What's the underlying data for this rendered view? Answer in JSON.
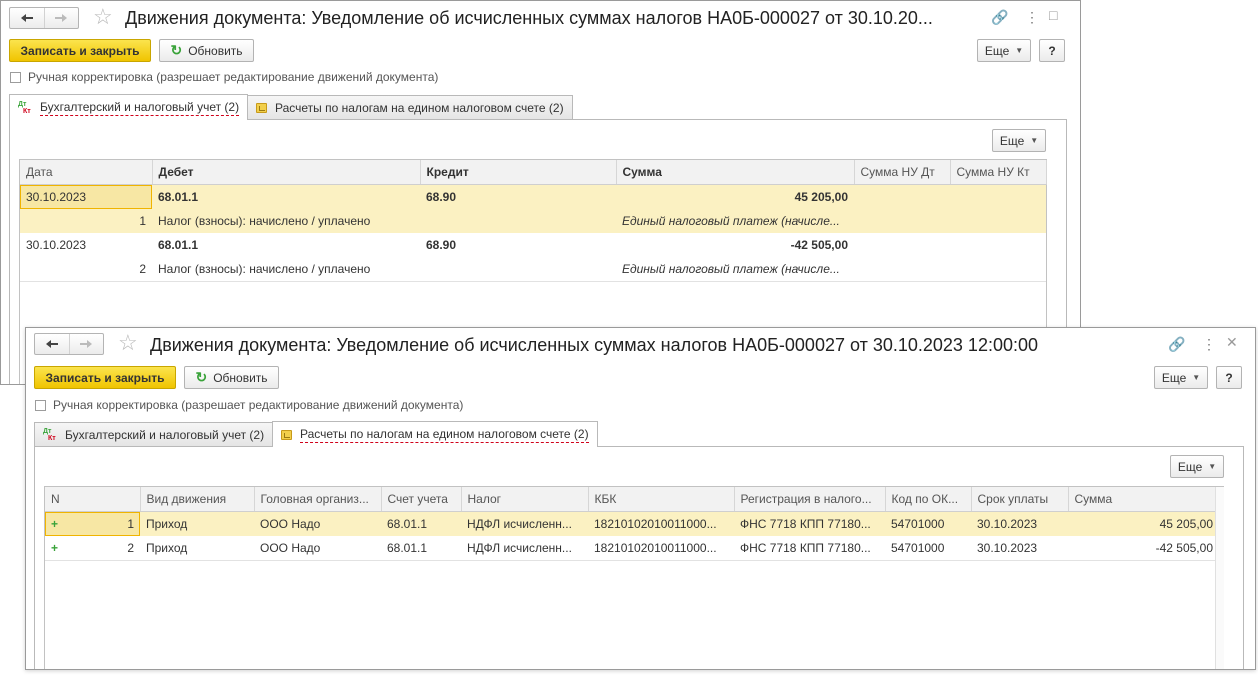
{
  "windows": [
    {
      "title": "Движения документа: Уведомление об исчисленных суммах налогов НА0Б-000027 от 30.10.20...",
      "save_close": "Записать и закрыть",
      "refresh": "Обновить",
      "more": "Еще",
      "help": "?",
      "manual_label": "Ручная корректировка (разрешает редактирование движений документа)",
      "tabs": [
        {
          "label": "Бухгалтерский и налоговый учет (2)"
        },
        {
          "label": "Расчеты по налогам на едином налоговом счете (2)"
        }
      ],
      "table_more": "Еще",
      "columns": [
        "Дата",
        "Дебет",
        "Кредит",
        "Сумма",
        "Сумма НУ Дт",
        "Сумма НУ Кт"
      ],
      "rows": [
        {
          "date": "30.10.2023",
          "debit": "68.01.1",
          "credit": "68.90",
          "sum": "45 205,00",
          "num": "1",
          "debit_sub": "Налог (взносы): начислено / уплачено",
          "content": "Единый налоговый платеж (начисле..."
        },
        {
          "date": "30.10.2023",
          "debit": "68.01.1",
          "credit": "68.90",
          "sum": "-42 505,00",
          "num": "2",
          "debit_sub": "Налог (взносы): начислено / уплачено",
          "content": "Единый налоговый платеж (начисле..."
        }
      ]
    },
    {
      "title": "Движения документа: Уведомление об исчисленных суммах налогов НА0Б-000027 от 30.10.2023 12:00:00",
      "save_close": "Записать и закрыть",
      "refresh": "Обновить",
      "more": "Еще",
      "help": "?",
      "manual_label": "Ручная корректировка (разрешает редактирование движений документа)",
      "tabs": [
        {
          "label": "Бухгалтерский и налоговый учет (2)"
        },
        {
          "label": "Расчеты по налогам на едином налоговом счете (2)"
        }
      ],
      "table_more": "Еще",
      "columns": [
        "N",
        "Вид движения",
        "Головная организ...",
        "Счет учета",
        "Налог",
        "КБК",
        "Регистрация в налого...",
        "Код по ОК...",
        "Срок уплаты",
        "Сумма"
      ],
      "rows": [
        {
          "sign": "+",
          "n": "1",
          "kind": "Приход",
          "org": "ООО Надо",
          "account": "68.01.1",
          "tax": "НДФЛ исчисленн...",
          "kbk": "18210102010011000...",
          "reg": "ФНС 7718 КПП 77180...",
          "okt": "54701000",
          "due": "30.10.2023",
          "sum": "45 205,00"
        },
        {
          "sign": "+",
          "n": "2",
          "kind": "Приход",
          "org": "ООО Надо",
          "account": "68.01.1",
          "tax": "НДФЛ исчисленн...",
          "kbk": "18210102010011000...",
          "reg": "ФНС 7718 КПП 77180...",
          "okt": "54701000",
          "due": "30.10.2023",
          "sum": "-42 505,00"
        }
      ]
    }
  ],
  "colors": {
    "primary_button": "#f5d11d",
    "selected_row": "#fbf1c2",
    "negative": "#cc0000",
    "tab_underline": "#d0021b"
  }
}
